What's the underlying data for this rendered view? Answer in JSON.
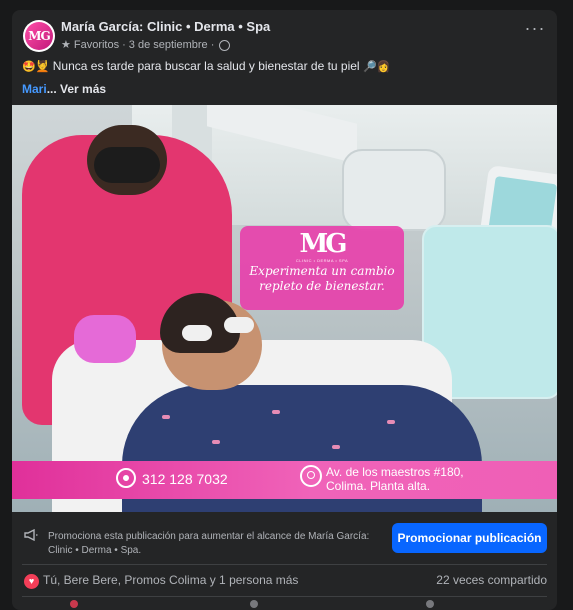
{
  "post": {
    "page_name": "María García: Clinic • Derma • Spa",
    "avatar_text": "MG",
    "meta_favorites": "Favoritos",
    "meta_separator": "·",
    "meta_date": "3 de septiembre",
    "meta_separator2": "·",
    "more_options": "···",
    "text_emoji_start": "🤩💆",
    "text": "Nunca es tarde para buscar la salud y bienestar de tu piel",
    "text_emoji_end": "🔎👩",
    "mention": "Mari",
    "see_more": "... Ver más"
  },
  "image": {
    "logo": "MG",
    "logo_sub": "CLINIC • DERMA • SPA",
    "headline_line1": "Experimenta un cambio",
    "headline_line2": "repleto de bienestar.",
    "phone": "312 128 7032",
    "address_line1": "Av. de los maestros #180,",
    "address_line2": "Colima. Planta alta.",
    "accent_color": "#e83aaa"
  },
  "promotion": {
    "text": "Promociona esta publicación para aumentar el alcance de María García: Clinic • Derma • Spa.",
    "button_label": "Promocionar publicación",
    "button_color": "#0866ff"
  },
  "engagement": {
    "reaction_icon": "heart-icon",
    "reaction_names": "Tú, Bere Bere, Promos Colima y 1 persona más",
    "share_count": "22 veces compartido"
  }
}
